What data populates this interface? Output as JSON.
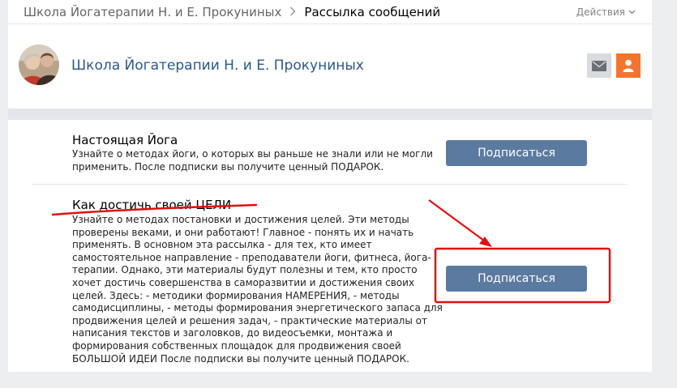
{
  "breadcrumb": {
    "parent": "Школа Йогатерапии Н. и Е. Прокуниных",
    "separator": ">",
    "current": "Рассылка сообщений"
  },
  "actions": {
    "label": "Действия"
  },
  "community": {
    "name": "Школа Йогатерапии Н. и Е. Прокуниных"
  },
  "mailings": [
    {
      "title": "Настоящая Йога",
      "description": "Узнайте о методах йоги, о которых вы раньше не знали или не могли применить. После подписки вы получите ценный ПОДАРОК.",
      "button": "Подписаться"
    },
    {
      "title": "Как достичь своей ЦЕЛИ",
      "description": "Узнайте о методах постановки и достижения целей. Эти методы проверены веками, и они работают! Главное - понять их и начать применять. В основном эта рассылка - для тех, кто имеет самостоятельное направление - преподаватели йоги, фитнеса, йога-терапии. Однако, эти материалы будут полезны и тем, кто просто хочет достичь совершенства в саморазвитии и достижения своих целей. Здесь: - методики формирования НАМЕРЕНИЯ, - методы самодисциплины, - методы формирования энергетического запаса для продвижения целей и решения задач, - практические материалы от написания текстов и заголовков, до видеосъемки, монтажа и формирования собственных площадок для продвижения своей БОЛЬШОЙ ИДЕИ После подписки вы получите ценный ПОДАРОК.",
      "button": "Подписаться"
    }
  ],
  "colors": {
    "link": "#2a5885",
    "button": "#5b7a9f",
    "accent_orange": "#f1752e",
    "annotation_red": "#e01010"
  },
  "icons": [
    "chevron-right-icon",
    "chevron-down-icon",
    "mail-icon",
    "user-icon"
  ]
}
